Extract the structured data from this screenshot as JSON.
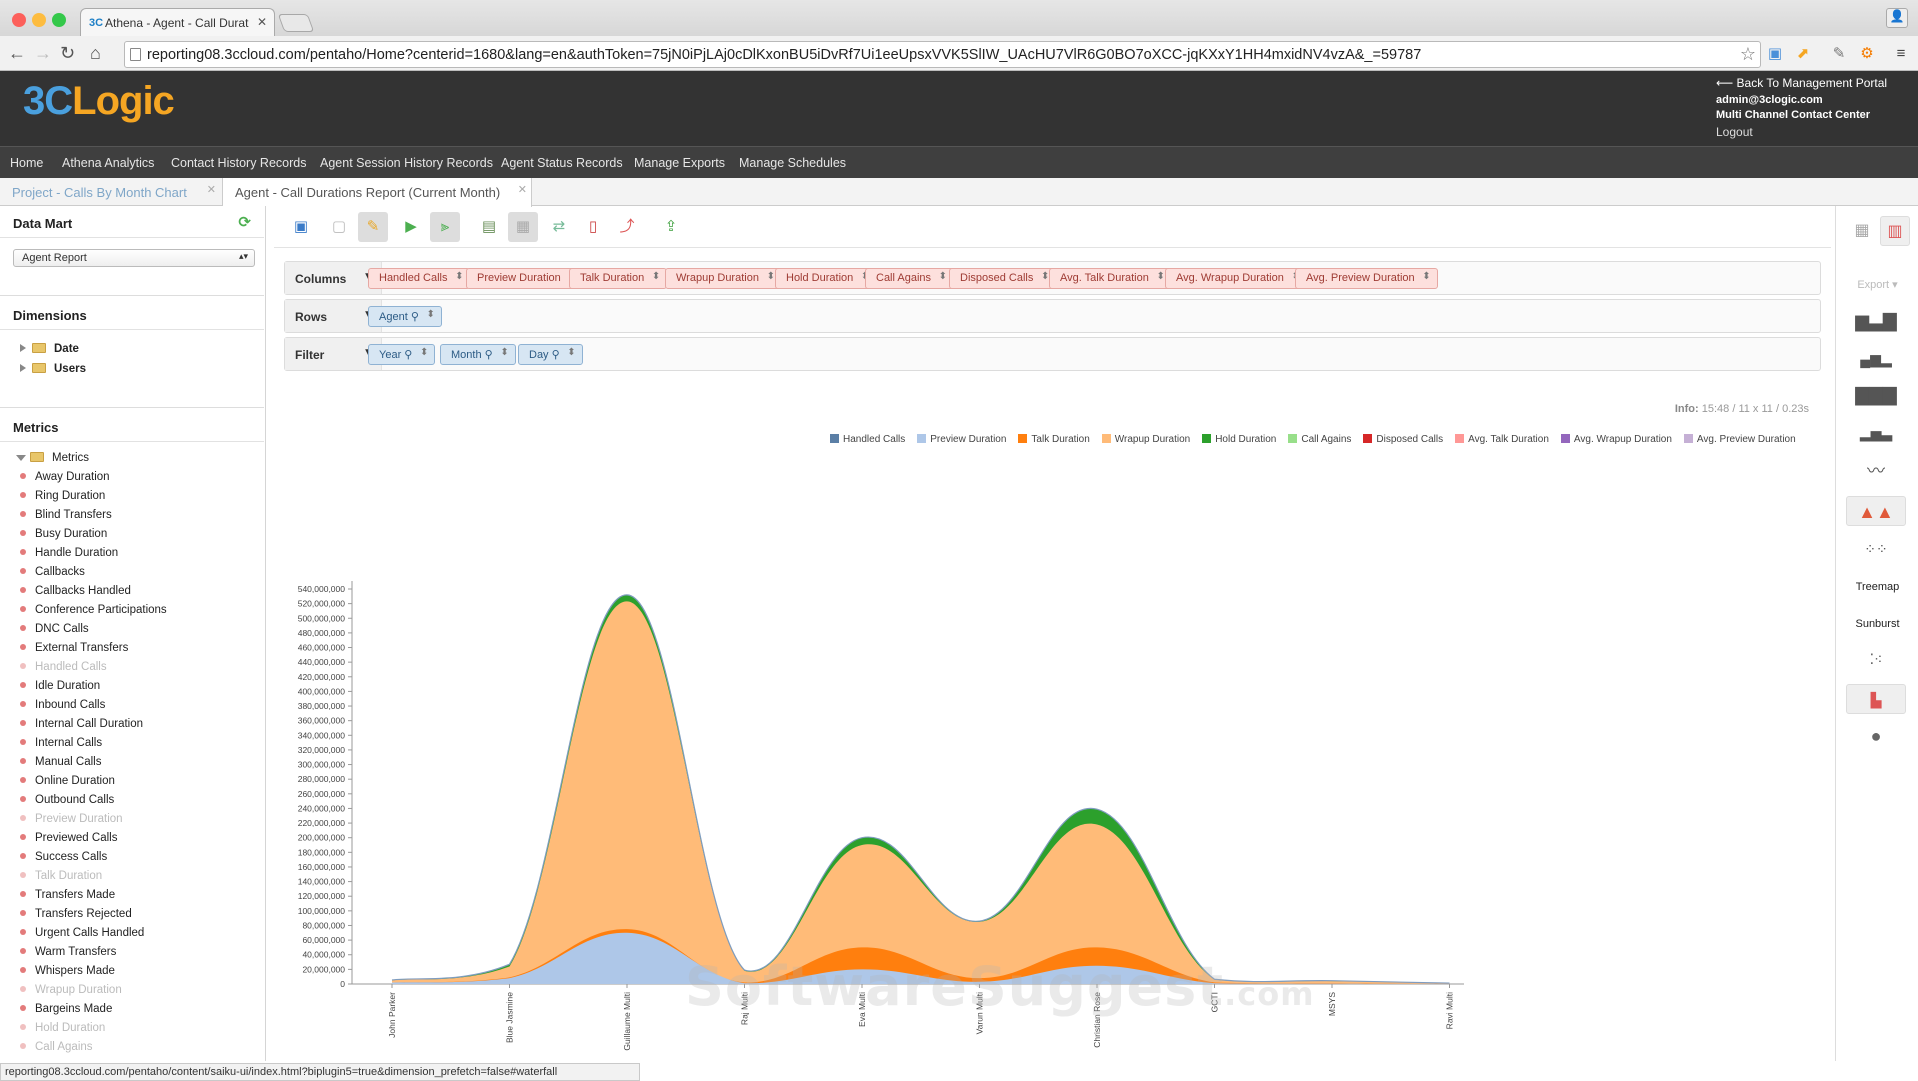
{
  "browser": {
    "tab_title": "Athena - Agent - Call Durat",
    "favicon": "3C",
    "url": "reporting08.3ccloud.com/pentaho/Home?centerid=1680&lang=en&authToken=75jN0iPjLAj0cDlKxonBU5iDvRf7Ui1eeUpsxVVK5SlIW_UAcHU7VlR6G0BO7oXCC-jqKXxY1HH4mxidNV4vzA&_=59787"
  },
  "header": {
    "logo_a": "3C",
    "logo_b": "Logic",
    "back_link": "Back To Management Portal",
    "user": "admin@3clogic.com",
    "org": "Multi Channel Contact Center",
    "logout": "Logout"
  },
  "nav": [
    "Home",
    "Athena Analytics",
    "Contact History Records",
    "Agent Session History Records",
    "Agent Status Records",
    "Manage Exports",
    "Manage Schedules"
  ],
  "workspace_tabs": [
    "Project - Calls By Month Chart",
    "Agent - Call Durations Report (Current Month)"
  ],
  "sidebar": {
    "datamart_title": "Data Mart",
    "datamart_selected": "Agent Report",
    "dimensions_title": "Dimensions",
    "dimensions": [
      "Date",
      "Users"
    ],
    "metrics_title": "Metrics",
    "metrics_folder": "Metrics",
    "metrics": [
      {
        "label": "Away Duration",
        "used": false
      },
      {
        "label": "Ring Duration",
        "used": false
      },
      {
        "label": "Blind Transfers",
        "used": false
      },
      {
        "label": "Busy Duration",
        "used": false
      },
      {
        "label": "Handle Duration",
        "used": false
      },
      {
        "label": "Callbacks",
        "used": false
      },
      {
        "label": "Callbacks Handled",
        "used": false
      },
      {
        "label": "Conference Participations",
        "used": false
      },
      {
        "label": "DNC Calls",
        "used": false
      },
      {
        "label": "External Transfers",
        "used": false
      },
      {
        "label": "Handled Calls",
        "used": true
      },
      {
        "label": "Idle Duration",
        "used": false
      },
      {
        "label": "Inbound Calls",
        "used": false
      },
      {
        "label": "Internal Call Duration",
        "used": false
      },
      {
        "label": "Internal Calls",
        "used": false
      },
      {
        "label": "Manual Calls",
        "used": false
      },
      {
        "label": "Online Duration",
        "used": false
      },
      {
        "label": "Outbound Calls",
        "used": false
      },
      {
        "label": "Preview Duration",
        "used": true
      },
      {
        "label": "Previewed Calls",
        "used": false
      },
      {
        "label": "Success Calls",
        "used": false
      },
      {
        "label": "Talk Duration",
        "used": true
      },
      {
        "label": "Transfers Made",
        "used": false
      },
      {
        "label": "Transfers Rejected",
        "used": false
      },
      {
        "label": "Urgent Calls Handled",
        "used": false
      },
      {
        "label": "Warm Transfers",
        "used": false
      },
      {
        "label": "Whispers Made",
        "used": false
      },
      {
        "label": "Wrapup Duration",
        "used": true
      },
      {
        "label": "Bargeins Made",
        "used": false
      },
      {
        "label": "Hold Duration",
        "used": true
      },
      {
        "label": "Call Agains",
        "used": true
      }
    ]
  },
  "query": {
    "columns_label": "Columns",
    "rows_label": "Rows",
    "filter_label": "Filter",
    "columns": [
      "Handled Calls",
      "Preview Duration",
      "Talk Duration",
      "Wrapup Duration",
      "Hold Duration",
      "Call Agains",
      "Disposed Calls",
      "Avg. Talk Duration",
      "Avg. Wrapup Duration",
      "Avg. Preview Duration"
    ],
    "rows": [
      "Agent"
    ],
    "filters": [
      "Year",
      "Month",
      "Day"
    ]
  },
  "info": {
    "label": "Info:",
    "time": "15:48",
    "dims": "11 x 11",
    "duration": "0.23s"
  },
  "right_panel": {
    "export": "Export",
    "treemap": "Treemap",
    "sunburst": "Sunburst"
  },
  "status_url": "reporting08.3ccloud.com/pentaho/content/saiku-ui/index.html?biplugin5=true&dimension_prefetch=false#waterfall",
  "watermark": {
    "main": "SoftwareSuggest",
    "tld": ".com"
  },
  "chart_data": {
    "type": "area",
    "stacked": true,
    "smooth": true,
    "categories": [
      "John Parker",
      "Blue Jasmine",
      "Guillaume Multi",
      "Raj Multi",
      "Eva Multi",
      "Varun Multi",
      "Christian Rose",
      "GCTI",
      "MSYS",
      "Ravi Multi"
    ],
    "ylim": [
      0,
      540000000
    ],
    "yticks": [
      0,
      20000000,
      40000000,
      60000000,
      80000000,
      100000000,
      120000000,
      140000000,
      160000000,
      180000000,
      200000000,
      220000000,
      240000000,
      260000000,
      280000000,
      300000000,
      320000000,
      340000000,
      360000000,
      380000000,
      400000000,
      420000000,
      440000000,
      460000000,
      480000000,
      500000000,
      520000000,
      540000000
    ],
    "ytick_labels": [
      "0",
      "20,000,000",
      "40,000,000",
      "60,000,000",
      "80,000,000",
      "100,000,000",
      "120,000,000",
      "140,000,000",
      "160,000,000",
      "180,000,000",
      "200,000,000",
      "220,000,000",
      "240,000,000",
      "260,000,000",
      "280,000,000",
      "300,000,000",
      "320,000,000",
      "340,000,000",
      "360,000,000",
      "380,000,000",
      "400,000,000",
      "420,000,000",
      "440,000,000",
      "460,000,000",
      "480,000,000",
      "500,000,000",
      "520,000,000",
      "540,000,000"
    ],
    "legend_position": "top-right",
    "series": [
      {
        "name": "Handled Calls",
        "color": "#5b7fa6",
        "values": [
          0,
          0,
          0,
          0,
          0,
          0,
          0,
          0,
          0,
          0
        ]
      },
      {
        "name": "Preview Duration",
        "color": "#aec7e8",
        "values": [
          2000000,
          8000000,
          70000000,
          1000000,
          20000000,
          3000000,
          25000000,
          1000000,
          500000,
          200000
        ]
      },
      {
        "name": "Talk Duration",
        "color": "#ff7f0e",
        "values": [
          0,
          1000000,
          5000000,
          1000000,
          30000000,
          5000000,
          25000000,
          1000000,
          500000,
          0
        ]
      },
      {
        "name": "Wrapup Duration",
        "color": "#ffbb78",
        "values": [
          3000000,
          15000000,
          448000000,
          16000000,
          140000000,
          77000000,
          168000000,
          4000000,
          3000000,
          1000000
        ]
      },
      {
        "name": "Hold Duration",
        "color": "#2ca02c",
        "values": [
          500000,
          3000000,
          9000000,
          1000000,
          10000000,
          1000000,
          21000000,
          500000,
          500000,
          0
        ]
      },
      {
        "name": "Call Agains",
        "color": "#98df8a",
        "values": [
          0,
          0,
          0,
          0,
          0,
          0,
          0,
          0,
          0,
          0
        ]
      },
      {
        "name": "Disposed Calls",
        "color": "#d62728",
        "values": [
          0,
          0,
          0,
          0,
          0,
          0,
          0,
          0,
          0,
          0
        ]
      },
      {
        "name": "Avg. Talk Duration",
        "color": "#ff9896",
        "values": [
          0,
          0,
          0,
          0,
          0,
          0,
          0,
          0,
          0,
          0
        ]
      },
      {
        "name": "Avg. Wrapup Duration",
        "color": "#9467bd",
        "values": [
          0,
          0,
          0,
          0,
          0,
          0,
          0,
          0,
          0,
          0
        ]
      },
      {
        "name": "Avg. Preview Duration",
        "color": "#c5b0d5",
        "values": [
          0,
          0,
          0,
          0,
          0,
          0,
          0,
          0,
          0,
          0
        ]
      }
    ]
  }
}
